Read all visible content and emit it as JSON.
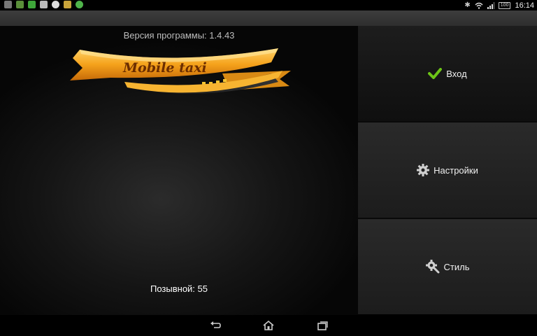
{
  "status_bar": {
    "time": "16:14",
    "battery": "100",
    "icons": [
      "sd-card-icon",
      "download-icon",
      "android-icon",
      "image-icon",
      "chrome-icon",
      "cleaner-icon",
      "coin-icon"
    ],
    "right_icons": [
      "bluetooth-icon",
      "wifi-icon",
      "signal-icon",
      "battery-icon"
    ]
  },
  "main": {
    "version": "Версия программы: 1.4.43",
    "logo_text": "Mobile taxi",
    "callsign": "Позывной: 55"
  },
  "menu": {
    "login": "Вход",
    "settings": "Настройки",
    "style": "Стиль"
  },
  "colors": {
    "accent_orange": "#f5a21b",
    "check_green": "#6cc417"
  }
}
